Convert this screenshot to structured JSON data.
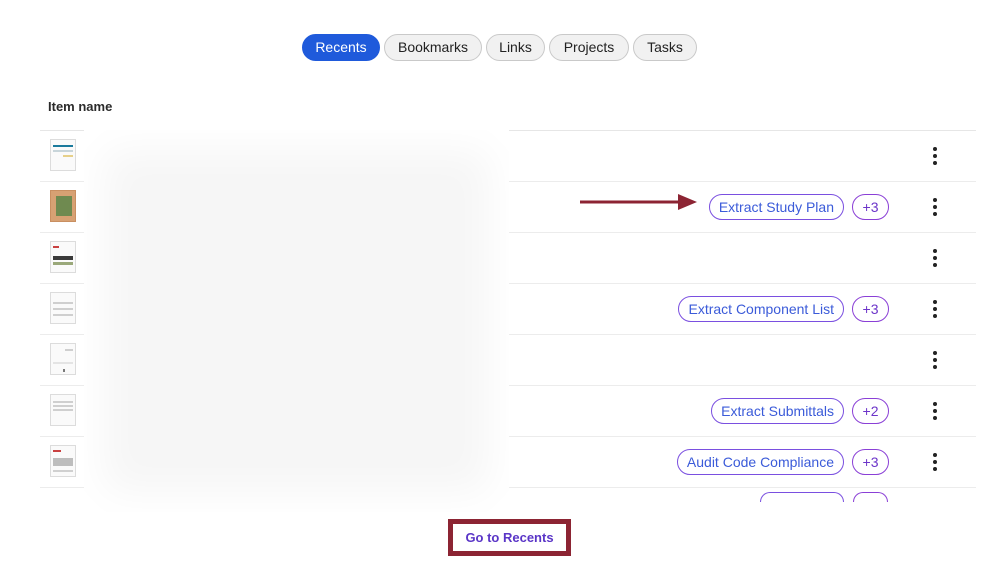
{
  "tabs": [
    {
      "label": "Recents",
      "active": true
    },
    {
      "label": "Bookmarks",
      "active": false
    },
    {
      "label": "Links",
      "active": false
    },
    {
      "label": "Projects",
      "active": false
    },
    {
      "label": "Tasks",
      "active": false
    }
  ],
  "table": {
    "column_header": "Item name",
    "rows": [
      {
        "thumbnail": "document-thumbnail",
        "chip": null,
        "count": null
      },
      {
        "thumbnail": "photo-thumbnail",
        "chip": "Extract Study Plan",
        "count": "+3"
      },
      {
        "thumbnail": "document-thumbnail",
        "chip": null,
        "count": null
      },
      {
        "thumbnail": "drawing-thumbnail",
        "chip": "Extract Component List",
        "count": "+3"
      },
      {
        "thumbnail": "document-thumbnail",
        "chip": null,
        "count": null
      },
      {
        "thumbnail": "document-thumbnail",
        "chip": "Extract Submittals",
        "count": "+2"
      },
      {
        "thumbnail": "drawing-thumbnail",
        "chip": "Audit Code Compliance",
        "count": "+3"
      }
    ]
  },
  "footer": {
    "go_recents_label": "Go to Recents"
  },
  "colors": {
    "active_tab": "#1f5adb",
    "chip_border": "#7a4fe0",
    "annotation": "#8c2433"
  },
  "icons": {
    "row_menu": "more-vertical-icon",
    "annotation": "arrow-right-icon"
  }
}
